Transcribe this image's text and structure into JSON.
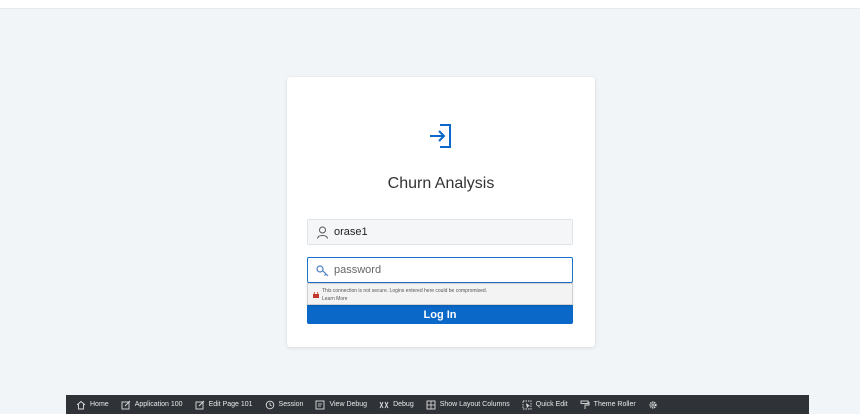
{
  "app": {
    "title": "Churn Analysis"
  },
  "login": {
    "username_value": "orase1",
    "password_placeholder": "password",
    "insecure_warning": "This connection is not secure. Logins entered here could be compromised.",
    "learn_more": "Learn More",
    "login_button": "Log In"
  },
  "dev_toolbar": {
    "items": [
      {
        "label": "Home",
        "icon": "home-icon"
      },
      {
        "label": "Application 100",
        "icon": "edit-app-icon"
      },
      {
        "label": "Edit Page 101",
        "icon": "edit-page-icon"
      },
      {
        "label": "Session",
        "icon": "session-icon"
      },
      {
        "label": "View Debug",
        "icon": "view-debug-icon"
      },
      {
        "label": "Debug",
        "icon": "debug-icon"
      },
      {
        "label": "Show Layout Columns",
        "icon": "grid-icon"
      },
      {
        "label": "Quick Edit",
        "icon": "quick-edit-icon"
      },
      {
        "label": "Theme Roller",
        "icon": "paint-roller-icon"
      }
    ],
    "settings_icon": "gear-icon"
  },
  "colors": {
    "accent": "#0a68c8",
    "background": "#f2f5f8",
    "toolbar": "#2f3338"
  }
}
